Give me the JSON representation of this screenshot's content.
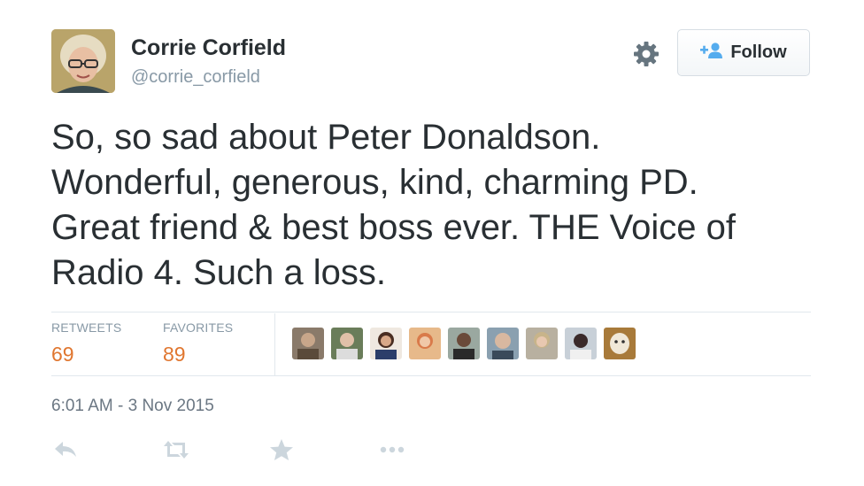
{
  "user": {
    "name": "Corrie Corfield",
    "handle": "@corrie_corfield"
  },
  "header": {
    "follow_label": "Follow",
    "gear_icon": "gear-icon",
    "follow_icon": "add-user-icon"
  },
  "tweet": {
    "lines": [
      "So, so sad about Peter Donaldson.",
      "Wonderful, generous, kind, charming PD.",
      "Great friend & best boss ever. THE Voice of",
      "Radio 4. Such a loss."
    ]
  },
  "stats": {
    "retweets_label": "RETWEETS",
    "retweets_count": "69",
    "favorites_label": "FAVORITES",
    "favorites_count": "89"
  },
  "favoriters_count": 9,
  "timestamp": "6:01 AM - 3 Nov 2015",
  "actions": [
    "reply-icon",
    "retweet-icon",
    "favorite-star-icon",
    "more-icon"
  ],
  "colors": {
    "stat_value": "#e0762f",
    "muted": "#8899a6",
    "action_icon": "#ccd6dd"
  }
}
